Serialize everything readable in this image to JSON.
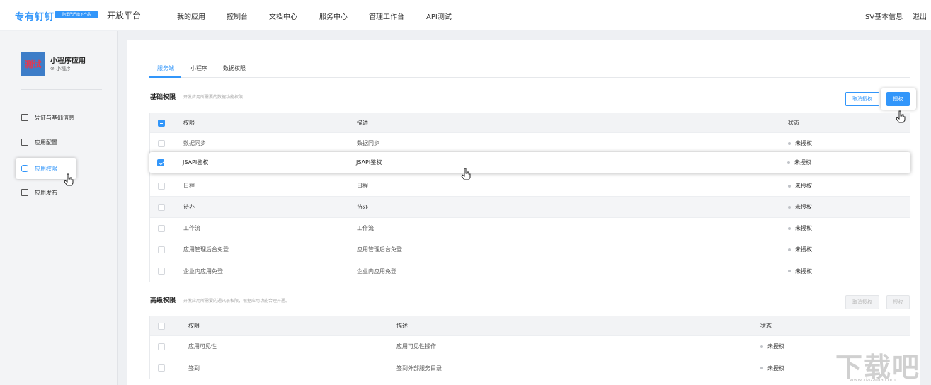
{
  "header": {
    "logo": "专有钉钉",
    "logo_badge": "阿里巴巴旗下产品",
    "platform": "开放平台",
    "nav": [
      "我的应用",
      "控制台",
      "文档中心",
      "服务中心",
      "管理工作台",
      "API测试"
    ],
    "isv_info": "ISV基本信息",
    "logout": "退出"
  },
  "sidebar": {
    "app_icon_text": "测试",
    "app_name": "小程序应用",
    "app_type": "⊘ 小程序",
    "items": [
      {
        "label": "凭证与基础信息",
        "icon": "credential-icon"
      },
      {
        "label": "应用配置",
        "icon": "config-icon"
      },
      {
        "label": "应用权限",
        "icon": "lock-icon",
        "active": true
      },
      {
        "label": "应用发布",
        "icon": "publish-icon"
      }
    ]
  },
  "tabs": [
    "服务端",
    "小程序",
    "数据权限"
  ],
  "basic": {
    "title": "基础权限",
    "desc": "开发应用所需要的数据功能权限",
    "cancel_label": "取消授权",
    "grant_label": "授权",
    "columns": [
      "权限",
      "描述",
      "状态"
    ],
    "rows": [
      {
        "name": "数据同步",
        "desc": "数据同步",
        "status": "未授权",
        "checked": false
      },
      {
        "name": "JSAPI鉴权",
        "desc": "JSAPI鉴权",
        "status": "未授权",
        "checked": true
      },
      {
        "name": "日程",
        "desc": "日程",
        "status": "未授权",
        "checked": false
      },
      {
        "name": "待办",
        "desc": "待办",
        "status": "未授权",
        "checked": false
      },
      {
        "name": "工作流",
        "desc": "工作流",
        "status": "未授权",
        "checked": false
      },
      {
        "name": "应用管理后台免登",
        "desc": "应用管理后台免登",
        "status": "未授权",
        "checked": false
      },
      {
        "name": "企业内应用免登",
        "desc": "企业内应用免登",
        "status": "未授权",
        "checked": false
      }
    ]
  },
  "advanced": {
    "title": "高级权限",
    "desc": "开发应用所需要的通讯录权限，根据应用功能合理开通。",
    "cancel_label": "取消授权",
    "grant_label": "授权",
    "columns": [
      "权限",
      "描述",
      "状态"
    ],
    "rows": [
      {
        "name": "应用可见性",
        "desc": "应用可见性操作",
        "status": "未授权"
      },
      {
        "name": "签到",
        "desc": "签到外部服务目录",
        "status": "未授权"
      }
    ]
  },
  "watermark": {
    "text": "下载吧",
    "sub": "www.xiazaiba.com"
  },
  "colors": {
    "accent": "#3296fa",
    "sidebar_bg": "#f3f4f6",
    "page_bg": "#eef0f3"
  }
}
